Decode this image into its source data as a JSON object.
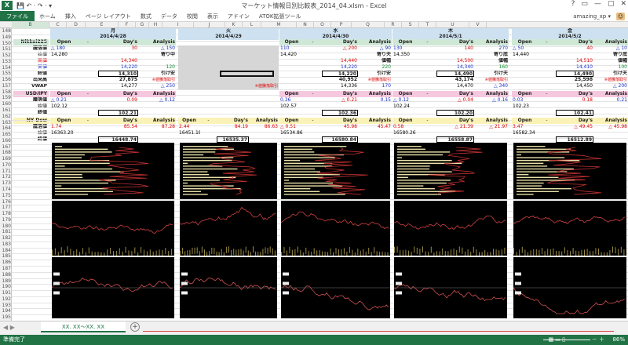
{
  "window": {
    "title": "マーケット情報日別比較表_2014_04.xlsm - Excel",
    "app_icon": "X",
    "quick_access": "💾 ↶ · ↷ · ▾",
    "controls": [
      "?",
      "▭",
      "—",
      "▢",
      "✕"
    ]
  },
  "ribbon": {
    "tabs": [
      "ファイル",
      "ホーム",
      "挿入",
      "ページ レイアウト",
      "数式",
      "データ",
      "校閲",
      "表示",
      "アドイン",
      "ATOK拡張ツール"
    ],
    "user": "amazing_xp ▾",
    "avatar": "☺"
  },
  "columns": [
    "B",
    "C",
    "D",
    "E",
    "F",
    "G",
    "H",
    "I",
    "J",
    "K",
    "L",
    "M",
    "N",
    "O",
    "P",
    "Q",
    "R",
    "S",
    "T",
    "U",
    "V"
  ],
  "rows": [
    "148",
    "149",
    "150",
    "151",
    "152",
    "153",
    "154",
    "155",
    "156",
    "157",
    "158",
    "159",
    "160",
    "161",
    "162",
    "163",
    "164",
    "165",
    "166",
    "167",
    "168",
    "169",
    "170",
    "171",
    "172",
    "173",
    "174",
    "175",
    "176",
    "177",
    "178",
    "179",
    "180",
    "181",
    "182",
    "183",
    "184",
    "185",
    "186",
    "187",
    "188",
    "189",
    "190",
    "191",
    "192",
    "193",
    "194",
    "195"
  ],
  "labels": {
    "nikkei": "Nikkei225",
    "diff": "騰落値",
    "open_val": "始値",
    "high": "高値",
    "low": "安値",
    "close": "終値",
    "volume": "出来高",
    "vwap": "VWAP",
    "usdjpy": "USD/JPY",
    "dow": "NY Dow"
  },
  "headers": {
    "open": "Open",
    "dash": "-",
    "days": "Day's",
    "analysis": "Analysis"
  },
  "note": "※値騰落取引",
  "days": [
    {
      "weekday": "月",
      "date": "2014/4/28",
      "holiday": false,
      "nk_diff": "△ 180",
      "nk_diff2": "30",
      "nk_ana": "△ 150",
      "nk_open": "14,280",
      "nk_open_note": "寄り中",
      "nk_high": "14,340",
      "nk_high_note": "",
      "nk_low": "14,220",
      "nk_low_diff": "120",
      "nk_close": "14,310",
      "nk_close_note": "引け安",
      "nk_vol": "27,875",
      "nk_vwap": "14,277",
      "nk_vwap_diff": "△ 250",
      "fx_diff": "△ 0.21",
      "fx_diff2": "0.09",
      "fx_ana": "△ 0.12",
      "fx_open": "102.12",
      "fx_close": "102.21",
      "dow_diff": "1.74",
      "dow_diff2": "85.54",
      "dow_ana": "87.28",
      "dow_open": "16363.20",
      "dow_close": "16448.74"
    },
    {
      "weekday": "火",
      "date": "2014/4/29",
      "holiday": true,
      "dow_diff": "2.44",
      "dow_diff2": "84.19",
      "dow_ana": "86.63",
      "dow_open": "16451.18",
      "dow_close": "16535.37"
    },
    {
      "weekday": "水",
      "date": "2014/4/30",
      "holiday": false,
      "nk_diff": "110",
      "nk_diff2": "△ 200",
      "nk_ana": "△ 90",
      "nk_open": "14,420",
      "nk_open_note": "寄り天",
      "nk_high": "14,440",
      "nk_high_note": "値幅",
      "nk_low": "14,220",
      "nk_low_diff": "220",
      "nk_close": "14,220",
      "nk_close_note": "引け安",
      "nk_vol": "40,952",
      "nk_vwap": "14,336",
      "nk_vwap_diff": "170",
      "fx_diff": "0.36",
      "fx_diff2": "△ 0.21",
      "fx_ana": "0.15",
      "fx_open": "102.57",
      "fx_close": "102.36",
      "dow_diff": "△ 0.51",
      "dow_diff2": "45.98",
      "dow_ana": "45.47",
      "dow_open": "16534.86",
      "dow_close": "16580.84"
    },
    {
      "weekday": "木",
      "date": "2014/5/1",
      "holiday": false,
      "nk_diff": "130",
      "nk_diff2": "140",
      "nk_ana": "270",
      "nk_open": "14,350",
      "nk_open_note": "寄り底",
      "nk_high": "14,500",
      "nk_high_note": "値幅",
      "nk_low": "14,340",
      "nk_low_diff": "160",
      "nk_close": "14,490",
      "nk_close_note": "引け天",
      "nk_vol": "43,174",
      "nk_vwap": "14,470",
      "nk_vwap_diff": "△ 340",
      "fx_diff": "△ 0.12",
      "fx_diff2": "△ 0.04",
      "fx_ana": "△ 0.16",
      "fx_open": "102.24",
      "fx_close": "102.20",
      "dow_diff": "0.58",
      "dow_diff2": "△ 21.39",
      "dow_ana": "△ 21.97",
      "dow_open": "16580.26",
      "dow_close": "16558.87"
    },
    {
      "weekday": "金",
      "date": "2014/5/2",
      "holiday": false,
      "nk_diff": "△ 50",
      "nk_diff2": "40",
      "nk_ana": "△ 10",
      "nk_open": "14,440",
      "nk_open_note": "寄り底",
      "nk_high": "14,510",
      "nk_high_note": "値幅",
      "nk_low": "14,410",
      "nk_low_diff": "100",
      "nk_close": "14,490",
      "nk_close_note": "引け天",
      "nk_vol": "25,598",
      "nk_vwap": "14,450",
      "nk_vwap_diff": "△ 200",
      "fx_diff": "0.03",
      "fx_diff2": "0.18",
      "fx_ana": "0.21",
      "fx_open": "102.23",
      "fx_close": "102.41",
      "dow_diff": "3.47",
      "dow_diff2": "△ 49.45",
      "dow_ana": "△ 45.98",
      "dow_open": "16582.34",
      "dow_close": "16512.89"
    }
  ],
  "sheet_tab": "XX. XX～XX. XX",
  "sheet_nav": "◀ ▶",
  "sheet_add": "+",
  "status": {
    "ready": "準備完了",
    "views": "▦ ▭ ▯",
    "zoom_controls": "－ ＋",
    "zoom": "86%"
  },
  "colors": {
    "accent": "#217346",
    "up": "#d00000",
    "down": "#1530c8",
    "green": "#0a8a2a"
  }
}
